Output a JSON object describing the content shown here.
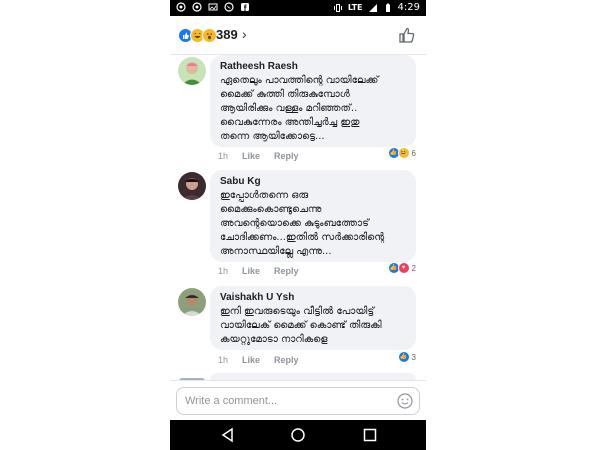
{
  "statusbar": {
    "network": "LTE",
    "time": "4:29"
  },
  "reactions": {
    "count": "389",
    "icons": [
      "like-icon",
      "haha-icon",
      "wow-icon"
    ],
    "like_color": "#1877f2",
    "haha_color": "#f7b928"
  },
  "comments": [
    {
      "name": "Ratheesh Raesh",
      "text": "ഏതെലും പാവത്തിന്റെ വായിലേക്ക്\nമൈക്ക് കുത്തി തിരുകുമ്പോൾ\nആയിരിക്കും വള്ളം മറിഞ്ഞത്..\nവൈകുന്നേരം അന്തിച്ചർച്ച ഇതു\nതന്നെ ആയിക്കോട്ടെ...",
      "time": "1h",
      "like": "Like",
      "reply": "Reply",
      "reactions": "6",
      "reaction_icons": [
        "like-icon",
        "haha-icon"
      ]
    },
    {
      "name": "Sabu Kg",
      "text": "ഇപ്പോൾതന്നെ ഒരു\nമൈക്കുംകൊണ്ടുചെന്നു\nഅവന്റെയൊക്കെ കുടുംബത്തോട്\nചോദിക്കണം...ഇതിൽ സർക്കാരിന്റെ\nഅനാസ്ഥയില്ലേ എന്നു...",
      "time": "1h",
      "like": "Like",
      "reply": "Reply",
      "reactions": "2",
      "reaction_icons": [
        "like-icon",
        "love-icon"
      ]
    },
    {
      "name": "Vaishakh U Ysh",
      "text": "ഇനി ഇവരുടെയും  വീട്ടിൽ പോയിട്ട്\nവായിലേക് മൈക്ക് കൊണ്ട് തിരുകി\nകയറ്റുമോടാ നാറികളെ",
      "time": "1h",
      "like": "Like",
      "reply": "Reply",
      "reactions": "3",
      "reaction_icons": [
        "like-icon"
      ]
    }
  ],
  "composer": {
    "placeholder": "Write a comment..."
  }
}
